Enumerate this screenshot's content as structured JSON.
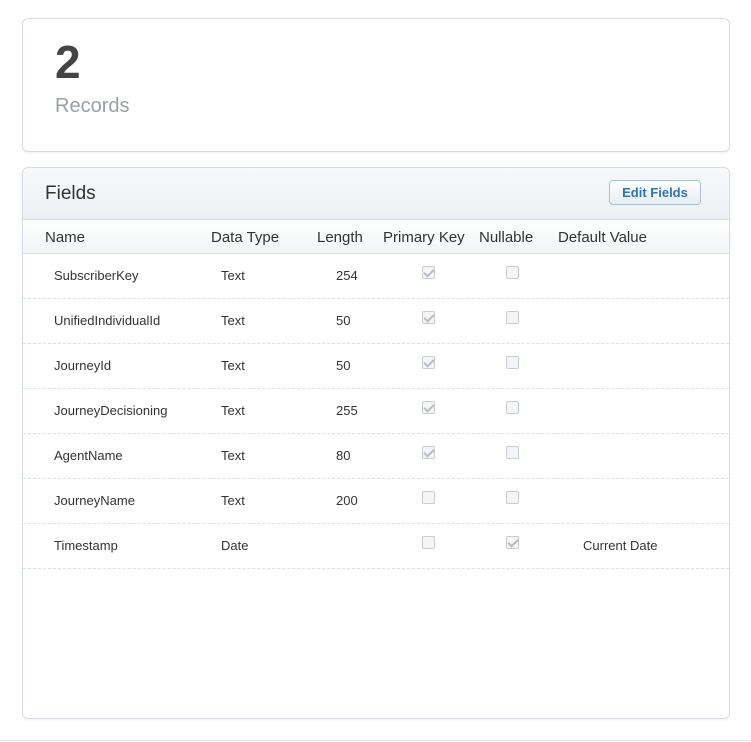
{
  "records": {
    "count": "2",
    "label": "Records"
  },
  "fields_panel": {
    "title": "Fields",
    "edit_button_label": "Edit Fields",
    "columns": [
      "Name",
      "Data Type",
      "Length",
      "Primary Key",
      "Nullable",
      "Default Value"
    ],
    "rows": [
      {
        "name": "SubscriberKey",
        "data_type": "Text",
        "length": "254",
        "primary_key": true,
        "nullable": false,
        "default_value": ""
      },
      {
        "name": "UnifiedIndividualId",
        "data_type": "Text",
        "length": "50",
        "primary_key": true,
        "nullable": false,
        "default_value": ""
      },
      {
        "name": "JourneyId",
        "data_type": "Text",
        "length": "50",
        "primary_key": true,
        "nullable": false,
        "default_value": ""
      },
      {
        "name": "JourneyDecisioning",
        "data_type": "Text",
        "length": "255",
        "primary_key": true,
        "nullable": false,
        "default_value": ""
      },
      {
        "name": "AgentName",
        "data_type": "Text",
        "length": "80",
        "primary_key": true,
        "nullable": false,
        "default_value": ""
      },
      {
        "name": "JourneyName",
        "data_type": "Text",
        "length": "200",
        "primary_key": false,
        "nullable": false,
        "default_value": ""
      },
      {
        "name": "Timestamp",
        "data_type": "Date",
        "length": "",
        "primary_key": false,
        "nullable": true,
        "default_value": "Current Date"
      }
    ]
  },
  "colors": {
    "accent": "#2f74b5",
    "border": "#d8dde3",
    "muted_text": "#9aa0a6"
  }
}
